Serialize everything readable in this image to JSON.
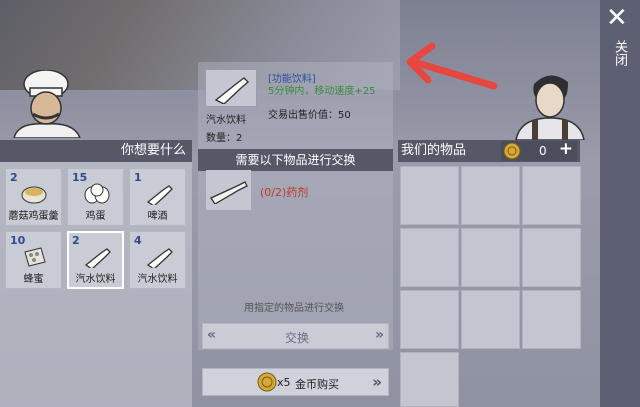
{
  "window": {
    "close_label": "关闭"
  },
  "detail": {
    "item_name": "汽水饮料",
    "category": "[功能饮料]",
    "effect": "5分钟内，移动速度+25",
    "sell_label": "交易出售价值：",
    "sell_value": "50",
    "quantity_label": "数量：",
    "quantity_value": "2"
  },
  "want_panel": {
    "title": "你想要什么",
    "items": [
      {
        "count": "2",
        "name": "蘑菇鸡蛋羹",
        "icon": "bowl-icon"
      },
      {
        "count": "15",
        "name": "鸡蛋",
        "icon": "eggs-icon"
      },
      {
        "count": "1",
        "name": "啤酒",
        "icon": "bottle-icon"
      },
      {
        "count": "10",
        "name": "蜂蜜",
        "icon": "honeycomb-icon"
      },
      {
        "count": "2",
        "name": "汽水饮料",
        "icon": "bottle-icon",
        "selected": true
      },
      {
        "count": "4",
        "name": "汽水饮料",
        "icon": "bottle-icon"
      }
    ]
  },
  "exchange": {
    "header": "需要以下物品进行交换",
    "requirement": "(0/2)药剂",
    "hint": "用指定的物品进行交换",
    "trade_button": "交换",
    "buy_prefix": "x5",
    "buy_label": "金币购买"
  },
  "our_items": {
    "title": "我们的物品",
    "coins": "0",
    "plus": "+"
  },
  "colors": {
    "accent_green": "#3c8a3c",
    "category_blue": "#2c4f9e",
    "requirement_red": "#c0392b",
    "arrow_red": "#e8473f"
  }
}
